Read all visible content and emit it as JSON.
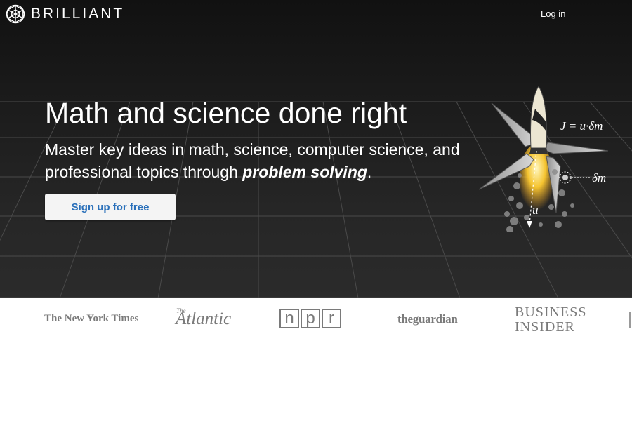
{
  "nav": {
    "brand": "BRILLIANT",
    "login": "Log in"
  },
  "hero": {
    "title": "Math and science done right",
    "subtitle_part1": "Master key ideas in math, science, computer science, and professional topics through ",
    "subtitle_emphasis": "problem solving",
    "subtitle_end": ".",
    "cta": "Sign up for free",
    "illustration": {
      "equation": "J = u·δm",
      "mass_label": "δm",
      "velocity_label": "u"
    }
  },
  "press": {
    "nyt": "The New York Times",
    "atlantic_prefix": "The",
    "atlantic": "Atlantic",
    "npr_letters": [
      "n",
      "p",
      "r"
    ],
    "guardian": "theguardian",
    "business_insider_line1": "BUSINESS",
    "business_insider_line2": "INSIDER"
  },
  "colors": {
    "hero_bg": "#1c1c1c",
    "button_text": "#2a70ba",
    "press_gray": "#7a7a7a"
  }
}
